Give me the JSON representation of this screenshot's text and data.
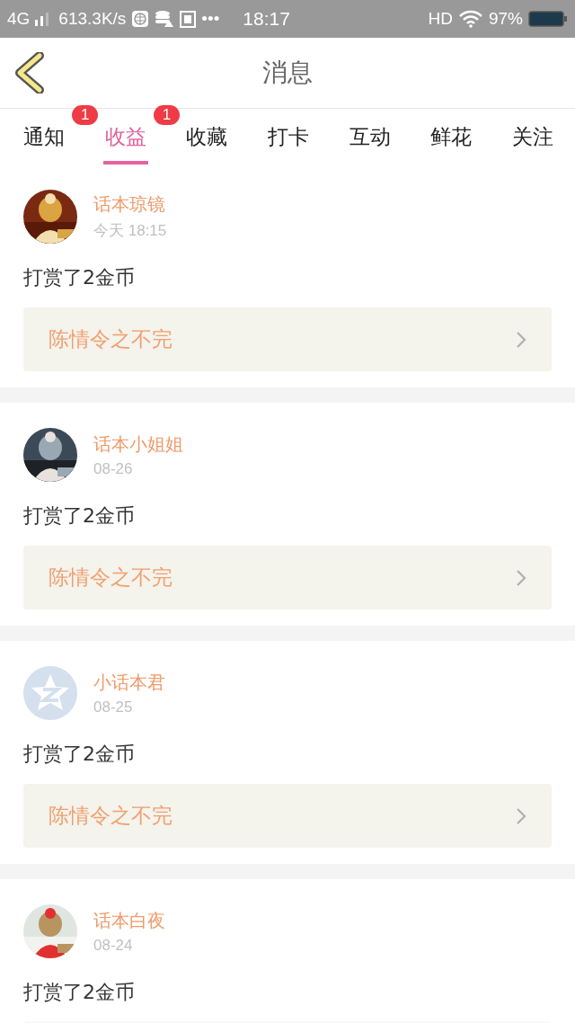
{
  "status_bar": {
    "network": "4G",
    "speed": "613.3K/s",
    "more": "•••",
    "time": "18:17",
    "hd": "HD",
    "battery": "97%"
  },
  "header": {
    "title": "消息"
  },
  "tabs": [
    {
      "label": "通知",
      "selected": false,
      "badge": "1"
    },
    {
      "label": "收益",
      "selected": true,
      "badge": "1"
    },
    {
      "label": "收藏",
      "selected": false
    },
    {
      "label": "打卡",
      "selected": false
    },
    {
      "label": "互动",
      "selected": false
    },
    {
      "label": "鲜花",
      "selected": false
    },
    {
      "label": "关注",
      "selected": false
    }
  ],
  "messages": [
    {
      "name": "话本琼镜",
      "time": "今天 18:15",
      "text": "打赏了2金币",
      "link": "陈情令之不完"
    },
    {
      "name": "话本小姐姐",
      "time": "08-26",
      "text": "打赏了2金币",
      "link": "陈情令之不完"
    },
    {
      "avatar": {
        "kind": "default"
      },
      "name": "小话本君",
      "time": "08-25",
      "text": "打赏了2金币",
      "link": "陈情令之不完"
    },
    {
      "name": "话本白夜",
      "time": "08-24",
      "text": "打赏了2金币"
    }
  ]
}
